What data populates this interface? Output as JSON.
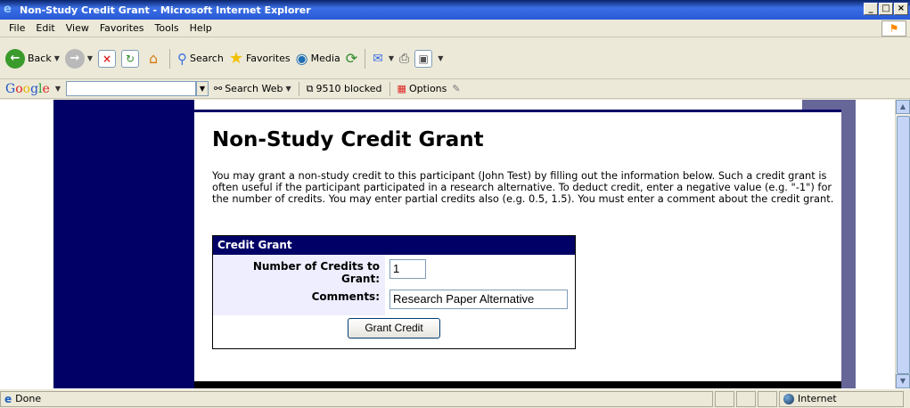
{
  "window": {
    "title": "Non-Study Credit Grant - Microsoft Internet Explorer"
  },
  "menu": [
    "File",
    "Edit",
    "View",
    "Favorites",
    "Tools",
    "Help"
  ],
  "toolbar": {
    "back": "Back",
    "search": "Search",
    "favorites": "Favorites",
    "media": "Media"
  },
  "google_bar": {
    "search_web": "Search Web",
    "blocked": "9510 blocked",
    "options": "Options"
  },
  "page": {
    "title": "Non-Study Credit Grant",
    "intro": "You may grant a non-study credit to this participant (John Test) by filling out the information below. Such a credit grant is often useful if the participant participated in a research alternative. To deduct credit, enter a negative value (e.g. \"-1\") for the number of credits. You may enter partial credits also (e.g. 0.5, 1.5). You must enter a comment about the credit grant.",
    "form": {
      "header": "Credit Grant",
      "credits_label": "Number of Credits to Grant:",
      "credits_value": "1",
      "comments_label": "Comments:",
      "comments_value": "Research Paper Alternative",
      "submit_label": "Grant Credit"
    }
  },
  "status": {
    "text": "Done",
    "zone": "Internet"
  }
}
